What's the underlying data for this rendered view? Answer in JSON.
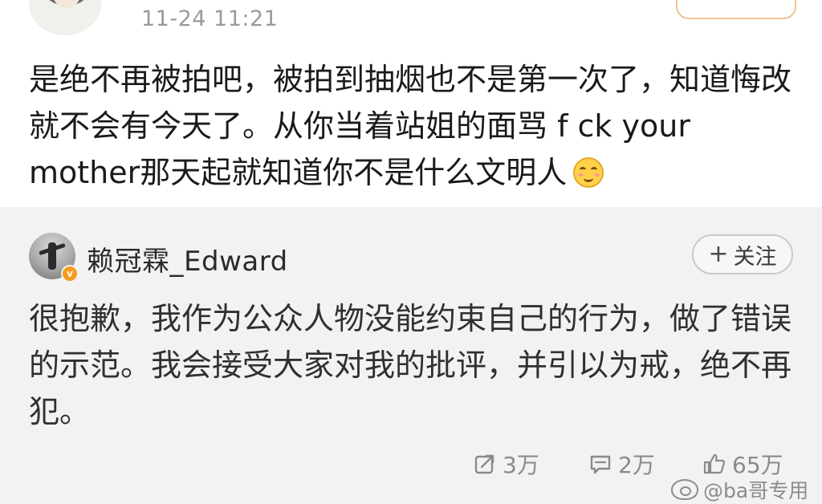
{
  "comment": {
    "timestamp": "11-24 11:21",
    "text": "是绝不再被拍吧，被拍到抽烟也不是第一次了，知道悔改就不会有今天了。从你当着站姐的面骂 f ck your mother那天起就知道你不是什么文明人",
    "emoji": "smile-emoji"
  },
  "reply": {
    "username": "赖冠霖_Edward",
    "follow_label": "关注",
    "follow_plus": "+",
    "verified_badge_label": "v",
    "text": "很抱歉，我作为公众人物没能约束自己的行为，做了错误的示范。我会接受大家对我的批评，并引以为戒，绝不再犯。"
  },
  "actions": {
    "repost_count": "3万",
    "comment_count": "2万",
    "like_count": "65万"
  },
  "watermark": {
    "text": "@ba哥专用"
  },
  "colors": {
    "background": "#f2f2f2",
    "card": "#ffffff",
    "muted_text": "#8a8a8a",
    "verified_orange": "#f59b1e"
  },
  "icons": [
    "repost-icon",
    "comment-icon",
    "like-icon",
    "weibo-logo-icon",
    "smile-emoji",
    "verified-badge-icon"
  ]
}
